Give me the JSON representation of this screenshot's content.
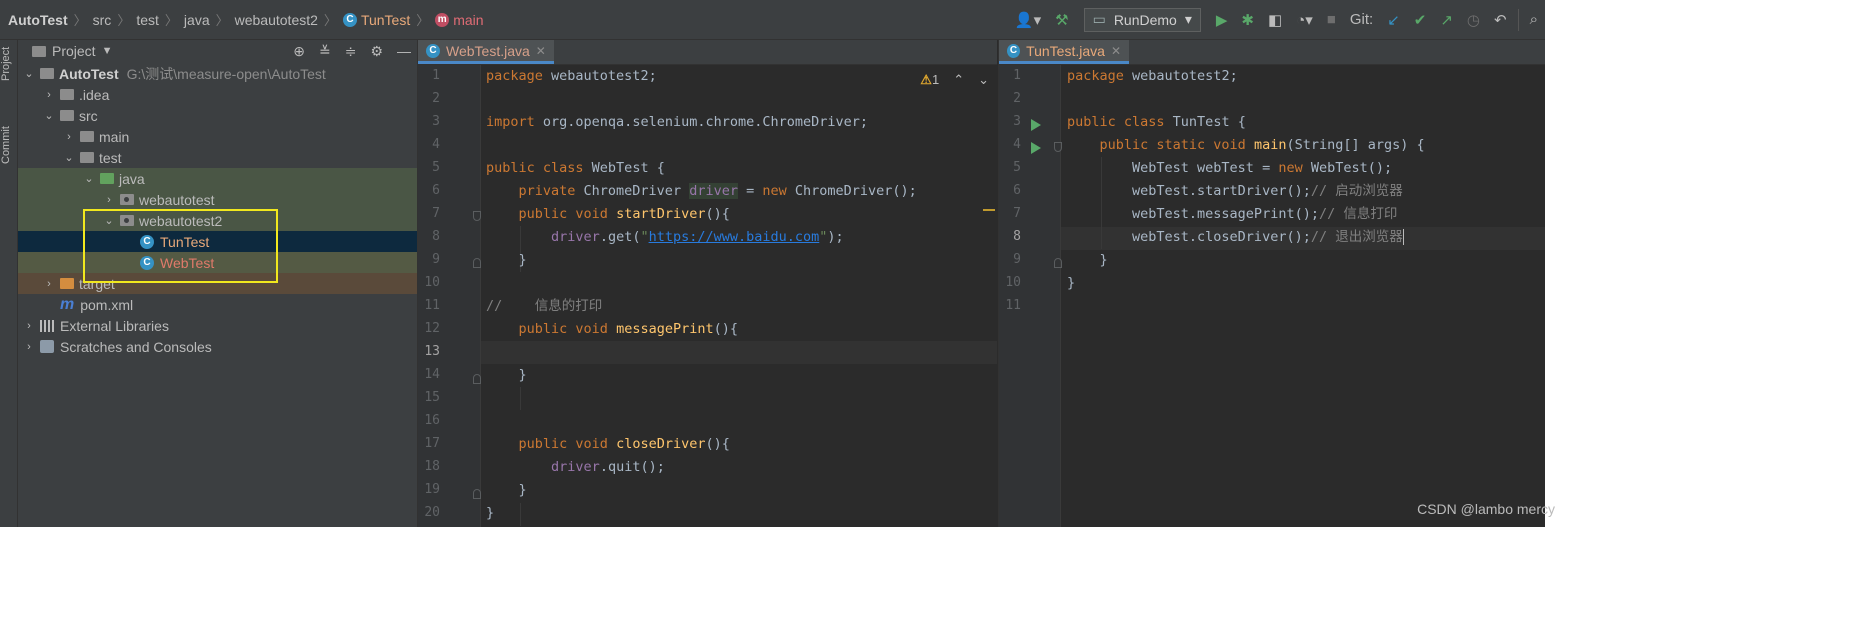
{
  "breadcrumb": {
    "project": "AutoTest",
    "src": "src",
    "test": "test",
    "java": "java",
    "package": "webautotest2",
    "class": "TunTest",
    "method": "main"
  },
  "toolbar": {
    "run_config": "RunDemo",
    "git_label": "Git:"
  },
  "sidebar_strip": {
    "project_label": "Project",
    "commit_label": "Commit"
  },
  "project_panel": {
    "title": "Project",
    "tree": [
      {
        "label": "AutoTest",
        "path": "G:\\测试\\measure-open\\AutoTest"
      },
      {
        "label": ".idea"
      },
      {
        "label": "src"
      },
      {
        "label": "main"
      },
      {
        "label": "test"
      },
      {
        "label": "java"
      },
      {
        "label": "webautotest"
      },
      {
        "label": "webautotest2"
      },
      {
        "label": "TunTest"
      },
      {
        "label": "WebTest"
      },
      {
        "label": "target"
      },
      {
        "label": "pom.xml"
      },
      {
        "label": "External Libraries"
      },
      {
        "label": "Scratches and Consoles"
      }
    ]
  },
  "editor_left": {
    "tab_label": "WebTest.java",
    "warning_count": "1",
    "line_numbers": [
      "1",
      "2",
      "3",
      "4",
      "5",
      "6",
      "7",
      "8",
      "9",
      "10",
      "11",
      "12",
      "13",
      "14",
      "15",
      "16",
      "17",
      "18",
      "19",
      "20"
    ],
    "current_line": 13
  },
  "editor_right": {
    "tab_label": "TunTest.java",
    "line_numbers": [
      "1",
      "2",
      "3",
      "4",
      "5",
      "6",
      "7",
      "8",
      "9",
      "10",
      "11"
    ],
    "current_line": 8
  },
  "code_left": {
    "l1a": "package",
    "l1b": " webautotest2;",
    "l3a": "import",
    "l3b": " org.openqa.selenium.chrome.ChromeDriver;",
    "l5a": "public class",
    "l5b": " WebTest {",
    "l6a": "    private",
    "l6b": " ChromeDriver ",
    "l6c": "driver",
    "l6d": " = ",
    "l6e": "new",
    "l6f": " ChromeDriver();",
    "l7a": "    public void",
    "l7b": " ",
    "l7c": "startDriver",
    "l7d": "(){",
    "l8a": "        ",
    "l8b": "driver",
    "l8c": ".get(",
    "l8d": "\"",
    "l8e": "https://www.baidu.com",
    "l8f": "\"",
    "l8g": ");",
    "l9": "    }",
    "l11": "//    信息的打印",
    "l12a": "    public void",
    "l12b": " ",
    "l12c": "messagePrint",
    "l12d": "(){",
    "l14": "    }",
    "l17a": "    public void",
    "l17b": " ",
    "l17c": "closeDriver",
    "l17d": "(){",
    "l18a": "        ",
    "l18b": "driver",
    "l18c": ".quit();",
    "l19": "    }",
    "l20": "}"
  },
  "code_right": {
    "l1a": "package",
    "l1b": " webautotest2;",
    "l3a": "public class",
    "l3b": " TunTest {",
    "l4a": "    public static void",
    "l4b": " ",
    "l4c": "main",
    "l4d": "(String[] args) {",
    "l5a": "        WebTest webTest = ",
    "l5b": "new",
    "l5c": " WebTest();",
    "l6a": "        webTest.startDriver();",
    "l6b": "// 启动浏览器",
    "l7a": "        webTest.messagePrint();",
    "l7b": "// 信息打印",
    "l8a": "        webTest.closeDriver();",
    "l8b": "// 退出浏览器",
    "l9": "    }",
    "l10": "}"
  },
  "watermark": "CSDN @lambo mercy",
  "colors": {
    "keyword": "#cc7832",
    "method": "#ffc66d",
    "field": "#9876aa",
    "string": "#6a8759",
    "comment": "#808080",
    "highlight_box": "#f1e81e"
  }
}
